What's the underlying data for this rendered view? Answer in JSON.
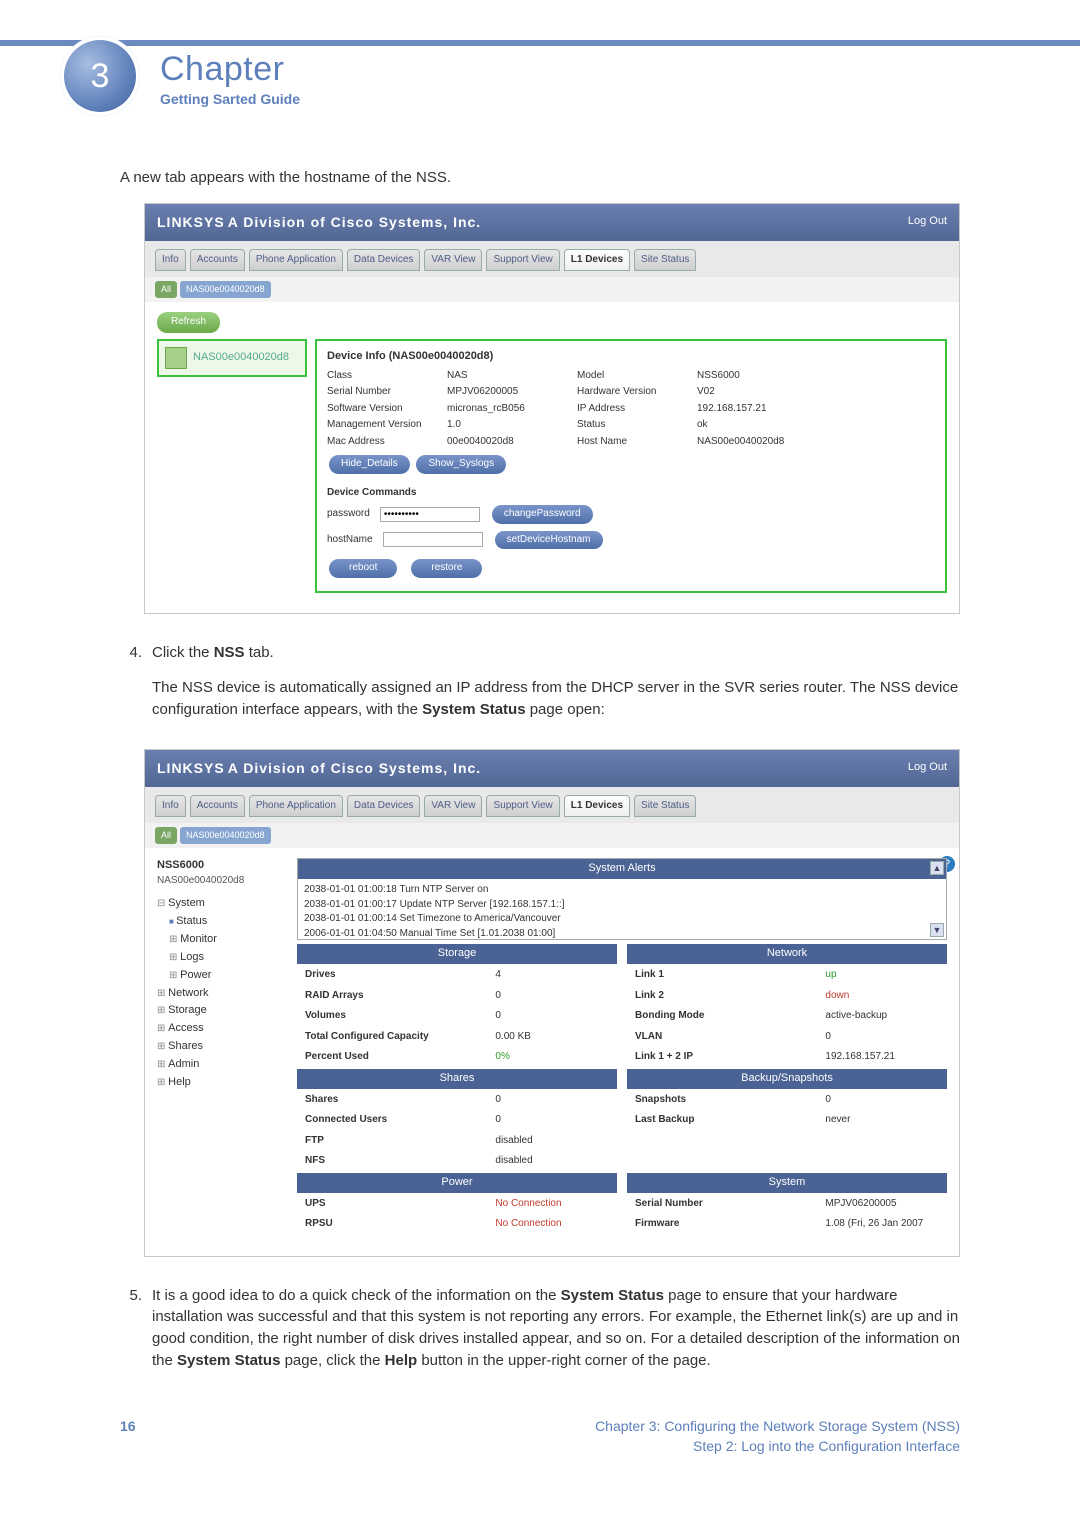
{
  "chapter": {
    "label": "Chapter",
    "number": "3",
    "subtitle": "Getting Sarted Guide"
  },
  "intro": "A new tab appears with the hostname of the NSS.",
  "step4": {
    "num": "4.",
    "line1_a": "Click the ",
    "line1_b": "NSS",
    "line1_c": " tab.",
    "para_a": "The NSS device is automatically assigned an IP address from the DHCP server in the SVR series router. The NSS device configuration interface appears, with the ",
    "para_b": "System Status",
    "para_c": " page open:"
  },
  "step5": {
    "num": "5.",
    "a": "It is a good idea to do a quick check of the information on the ",
    "b": "System Status",
    "c": " page to ensure that your hardware installation was successful and that this system is not reporting any errors. For example, the Ethernet link(s) are up and in good condition, the right number of disk drives installed appear, and so on. For a detailed description of the information on the ",
    "d": "System Status",
    "e": " page, click the ",
    "f": "Help",
    "g": " button in the upper-right corner of the page."
  },
  "ui": {
    "logo": "LINKSYS",
    "logo_sub": "A Division of Cisco Systems, Inc.",
    "logout": "Log Out",
    "tabs": [
      "Info",
      "Accounts",
      "Phone Application",
      "Data Devices",
      "VAR View",
      "Support View",
      "L1 Devices",
      "Site Status"
    ],
    "subtab_all": "All",
    "subtab_host": "NAS00e0040020d8",
    "refresh": "Refresh"
  },
  "device": {
    "tag": "NAS00e0040020d8",
    "title": "Device Info (NAS00e0040020d8)",
    "rows": [
      [
        "Class",
        "NAS",
        "Model",
        "NSS6000"
      ],
      [
        "Serial Number",
        "MPJV06200005",
        "Hardware Version",
        "V02"
      ],
      [
        "Software Version",
        "micronas_rcB056",
        "IP Address",
        "192.168.157.21"
      ],
      [
        "Management Version",
        "1.0",
        "Status",
        "ok"
      ],
      [
        "Mac Address",
        "00e0040020d8",
        "Host Name",
        "NAS00e0040020d8"
      ]
    ],
    "btn_hide": "Hide_Details",
    "btn_syslog": "Show_Syslogs",
    "cmds_title": "Device Commands",
    "password_label": "password",
    "hostname_label": "hostName",
    "btn_changepw": "changePassword",
    "btn_sethost": "setDeviceHostnam",
    "btn_reboot": "reboot",
    "btn_restore": "restore"
  },
  "nss": {
    "model": "NSS6000",
    "host": "NAS00e0040020d8",
    "menu": [
      {
        "label": "System",
        "open": true
      },
      {
        "label": "Status",
        "sub": true,
        "bullet": true
      },
      {
        "label": "Monitor",
        "sub": true
      },
      {
        "label": "Logs",
        "sub": true
      },
      {
        "label": "Power",
        "sub": true
      },
      {
        "label": "Network"
      },
      {
        "label": "Storage"
      },
      {
        "label": "Access"
      },
      {
        "label": "Shares"
      },
      {
        "label": "Admin"
      },
      {
        "label": "Help"
      }
    ],
    "alerts_title": "System Alerts",
    "alerts": [
      "2038-01-01 01:00:18 Turn NTP Server on",
      "2038-01-01 01:00:17 Update NTP Server [192.168.157.1::]",
      "2038-01-01 01:00:14 Set Timezone to America/Vancouver",
      "2006-01-01 01:04:50 Manual Time Set [1.01.2038 01:00]"
    ],
    "storage_title": "Storage",
    "network_title": "Network",
    "shares_title": "Shares",
    "backup_title": "Backup/Snapshots",
    "power_title": "Power",
    "system_title": "System",
    "storage": [
      [
        "Drives",
        "4"
      ],
      [
        "RAID Arrays",
        "0"
      ],
      [
        "Volumes",
        "0"
      ],
      [
        "Total Configured Capacity",
        "0.00 KB"
      ],
      [
        "Percent Used",
        "0%"
      ]
    ],
    "network": [
      [
        "Link 1",
        "up"
      ],
      [
        "Link 2",
        "down"
      ],
      [
        "Bonding Mode",
        "active-backup"
      ],
      [
        "VLAN",
        "0"
      ],
      [
        "Link 1 + 2 IP",
        "192.168.157.21"
      ]
    ],
    "shares": [
      [
        "Shares",
        "0"
      ],
      [
        "Connected Users",
        "0"
      ],
      [
        "FTP",
        "disabled"
      ],
      [
        "NFS",
        "disabled"
      ]
    ],
    "backup": [
      [
        "Snapshots",
        "0"
      ],
      [
        "Last Backup",
        "never"
      ]
    ],
    "power": [
      [
        "UPS",
        "No Connection"
      ],
      [
        "RPSU",
        "No Connection"
      ]
    ],
    "system": [
      [
        "Serial Number",
        "MPJV06200005"
      ],
      [
        "Firmware",
        "1.08 (Fri, 26 Jan 2007"
      ]
    ]
  },
  "footer": {
    "page": "16",
    "right1": "Chapter 3: Configuring the Network Storage System (NSS)",
    "right2": "Step 2: Log into the Configuration Interface"
  }
}
